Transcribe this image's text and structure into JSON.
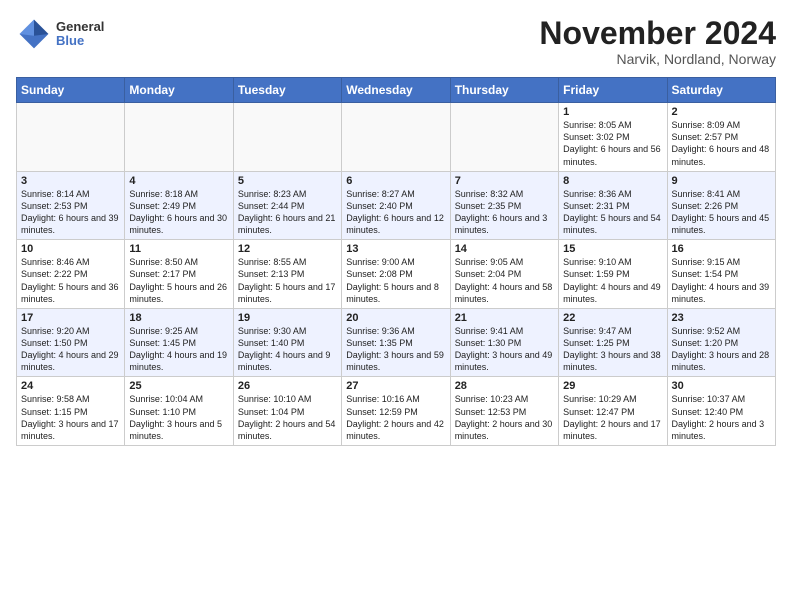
{
  "logo": {
    "line1": "General",
    "line2": "Blue"
  },
  "title": "November 2024",
  "subtitle": "Narvik, Nordland, Norway",
  "days_of_week": [
    "Sunday",
    "Monday",
    "Tuesday",
    "Wednesday",
    "Thursday",
    "Friday",
    "Saturday"
  ],
  "weeks": [
    [
      {
        "day": "",
        "info": ""
      },
      {
        "day": "",
        "info": ""
      },
      {
        "day": "",
        "info": ""
      },
      {
        "day": "",
        "info": ""
      },
      {
        "day": "",
        "info": ""
      },
      {
        "day": "1",
        "info": "Sunrise: 8:05 AM\nSunset: 3:02 PM\nDaylight: 6 hours and 56 minutes."
      },
      {
        "day": "2",
        "info": "Sunrise: 8:09 AM\nSunset: 2:57 PM\nDaylight: 6 hours and 48 minutes."
      }
    ],
    [
      {
        "day": "3",
        "info": "Sunrise: 8:14 AM\nSunset: 2:53 PM\nDaylight: 6 hours and 39 minutes."
      },
      {
        "day": "4",
        "info": "Sunrise: 8:18 AM\nSunset: 2:49 PM\nDaylight: 6 hours and 30 minutes."
      },
      {
        "day": "5",
        "info": "Sunrise: 8:23 AM\nSunset: 2:44 PM\nDaylight: 6 hours and 21 minutes."
      },
      {
        "day": "6",
        "info": "Sunrise: 8:27 AM\nSunset: 2:40 PM\nDaylight: 6 hours and 12 minutes."
      },
      {
        "day": "7",
        "info": "Sunrise: 8:32 AM\nSunset: 2:35 PM\nDaylight: 6 hours and 3 minutes."
      },
      {
        "day": "8",
        "info": "Sunrise: 8:36 AM\nSunset: 2:31 PM\nDaylight: 5 hours and 54 minutes."
      },
      {
        "day": "9",
        "info": "Sunrise: 8:41 AM\nSunset: 2:26 PM\nDaylight: 5 hours and 45 minutes."
      }
    ],
    [
      {
        "day": "10",
        "info": "Sunrise: 8:46 AM\nSunset: 2:22 PM\nDaylight: 5 hours and 36 minutes."
      },
      {
        "day": "11",
        "info": "Sunrise: 8:50 AM\nSunset: 2:17 PM\nDaylight: 5 hours and 26 minutes."
      },
      {
        "day": "12",
        "info": "Sunrise: 8:55 AM\nSunset: 2:13 PM\nDaylight: 5 hours and 17 minutes."
      },
      {
        "day": "13",
        "info": "Sunrise: 9:00 AM\nSunset: 2:08 PM\nDaylight: 5 hours and 8 minutes."
      },
      {
        "day": "14",
        "info": "Sunrise: 9:05 AM\nSunset: 2:04 PM\nDaylight: 4 hours and 58 minutes."
      },
      {
        "day": "15",
        "info": "Sunrise: 9:10 AM\nSunset: 1:59 PM\nDaylight: 4 hours and 49 minutes."
      },
      {
        "day": "16",
        "info": "Sunrise: 9:15 AM\nSunset: 1:54 PM\nDaylight: 4 hours and 39 minutes."
      }
    ],
    [
      {
        "day": "17",
        "info": "Sunrise: 9:20 AM\nSunset: 1:50 PM\nDaylight: 4 hours and 29 minutes."
      },
      {
        "day": "18",
        "info": "Sunrise: 9:25 AM\nSunset: 1:45 PM\nDaylight: 4 hours and 19 minutes."
      },
      {
        "day": "19",
        "info": "Sunrise: 9:30 AM\nSunset: 1:40 PM\nDaylight: 4 hours and 9 minutes."
      },
      {
        "day": "20",
        "info": "Sunrise: 9:36 AM\nSunset: 1:35 PM\nDaylight: 3 hours and 59 minutes."
      },
      {
        "day": "21",
        "info": "Sunrise: 9:41 AM\nSunset: 1:30 PM\nDaylight: 3 hours and 49 minutes."
      },
      {
        "day": "22",
        "info": "Sunrise: 9:47 AM\nSunset: 1:25 PM\nDaylight: 3 hours and 38 minutes."
      },
      {
        "day": "23",
        "info": "Sunrise: 9:52 AM\nSunset: 1:20 PM\nDaylight: 3 hours and 28 minutes."
      }
    ],
    [
      {
        "day": "24",
        "info": "Sunrise: 9:58 AM\nSunset: 1:15 PM\nDaylight: 3 hours and 17 minutes."
      },
      {
        "day": "25",
        "info": "Sunrise: 10:04 AM\nSunset: 1:10 PM\nDaylight: 3 hours and 5 minutes."
      },
      {
        "day": "26",
        "info": "Sunrise: 10:10 AM\nSunset: 1:04 PM\nDaylight: 2 hours and 54 minutes."
      },
      {
        "day": "27",
        "info": "Sunrise: 10:16 AM\nSunset: 12:59 PM\nDaylight: 2 hours and 42 minutes."
      },
      {
        "day": "28",
        "info": "Sunrise: 10:23 AM\nSunset: 12:53 PM\nDaylight: 2 hours and 30 minutes."
      },
      {
        "day": "29",
        "info": "Sunrise: 10:29 AM\nSunset: 12:47 PM\nDaylight: 2 hours and 17 minutes."
      },
      {
        "day": "30",
        "info": "Sunrise: 10:37 AM\nSunset: 12:40 PM\nDaylight: 2 hours and 3 minutes."
      }
    ]
  ]
}
